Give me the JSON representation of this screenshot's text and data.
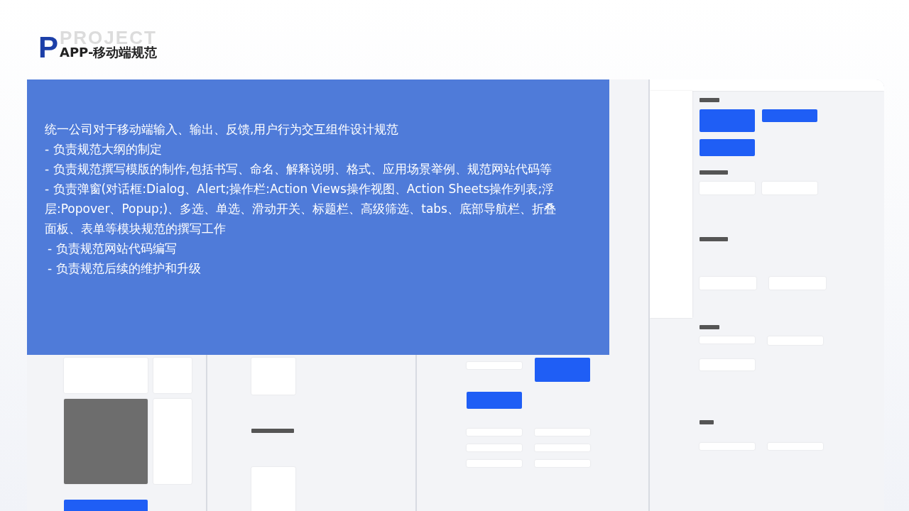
{
  "header": {
    "logo_letter": "P",
    "watermark": "PROJECT",
    "title": "APP-移动端规范"
  },
  "overlay": {
    "items": [
      {
        "kind": "lead",
        "text": "统一公司对于移动端输入、输出、反馈,用户行为交互组件设计规范"
      },
      {
        "kind": "hanging",
        "text": "- 负责规范大纲的制定"
      },
      {
        "kind": "hanging",
        "text": "- 负责规范撰写模版的制作,包括书写、命名、解释说明、格式、应用场景举例、规范网站代码等"
      },
      {
        "kind": "plain",
        "text": "- 负责弹窗(对话框:Dialog、Alert;操作栏:Action Views操作视图、Action Sheets操作列表;浮层:Popover、Popup;)、多选、单选、滑动开关、标题栏、高级筛选、tabs、底部导航栏、折叠面板、表单等模块规范的撰写工作"
      },
      {
        "kind": "indented",
        "text": "- 负责规范网站代码编写"
      },
      {
        "kind": "indented",
        "text": "- 负责规范后续的维护和升级"
      }
    ]
  }
}
